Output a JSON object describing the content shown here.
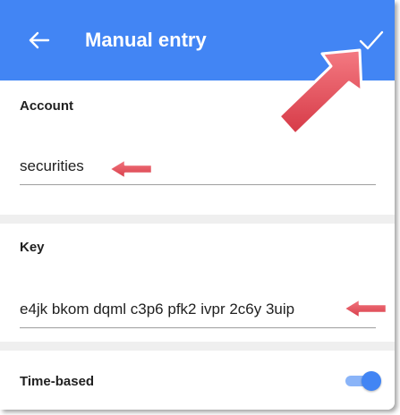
{
  "appbar": {
    "title": "Manual entry",
    "back_icon": "arrow-left-icon",
    "confirm_icon": "checkmark-icon",
    "color": "#4285f4"
  },
  "account": {
    "label": "Account",
    "value": "securities"
  },
  "key": {
    "label": "Key",
    "value": "e4jk bkom dqml c3p6 pfk2 ivpr 2c6y 3uip"
  },
  "time_based": {
    "label": "Time-based",
    "enabled": true
  },
  "annotations": {
    "arrow_color": "#e8505b",
    "arrow_icon": "red-pointer-arrow"
  }
}
